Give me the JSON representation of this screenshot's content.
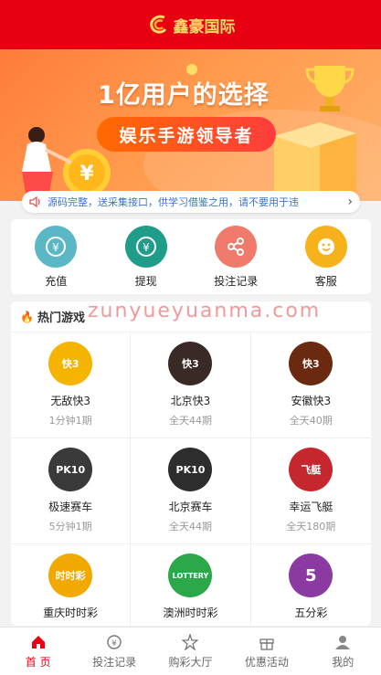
{
  "header": {
    "brand": "鑫豪国际",
    "logo_icon": "brand-logo-icon",
    "brand_color": "#e60012"
  },
  "banner": {
    "title": "1亿用户的选择",
    "subtitle": "娱乐手游领导者",
    "illustration_icons": [
      "trophy-icon",
      "coin-icon",
      "person-icon"
    ]
  },
  "notice": {
    "icon": "speaker-icon",
    "text": "源码完整，送采集接口，供学习借鉴之用，请不要用于违",
    "more_icon": "chevron-right-icon"
  },
  "quick_actions": [
    {
      "label": "充值",
      "icon": "recharge-icon",
      "color": "#5bb7c6"
    },
    {
      "label": "提现",
      "icon": "withdraw-icon",
      "color": "#1f9d8a"
    },
    {
      "label": "投注记录",
      "icon": "bet-record-icon",
      "color": "#f07a6b"
    },
    {
      "label": "客服",
      "icon": "customer-service-icon",
      "color": "#f6b21b"
    }
  ],
  "hot_section": {
    "title": "热门游戏",
    "flame_icon": "flame-icon"
  },
  "games": [
    {
      "name": "无敌快3",
      "info": "1分钟1期",
      "badge": "快3",
      "color": "#f5b400"
    },
    {
      "name": "北京快3",
      "info": "全天44期",
      "badge": "快3",
      "color": "#3a2a25"
    },
    {
      "name": "安徽快3",
      "info": "全天40期",
      "badge": "快3",
      "color": "#6b2a10"
    },
    {
      "name": "极速赛车",
      "info": "5分钟1期",
      "badge": "PK10",
      "color": "#3a3a3a"
    },
    {
      "name": "北京赛车",
      "info": "全天44期",
      "badge": "PK10",
      "color": "#2d2d2d"
    },
    {
      "name": "幸运飞艇",
      "info": "全天180期",
      "badge": "飞艇",
      "color": "#c6262e"
    },
    {
      "name": "重庆时时彩",
      "info": "",
      "badge": "时时彩",
      "color": "#f1a900"
    },
    {
      "name": "澳洲时时彩",
      "info": "",
      "badge": "LOTTERY",
      "color": "#2aa84a"
    },
    {
      "name": "五分彩",
      "info": "",
      "badge": "5",
      "color": "#8a3aa0"
    }
  ],
  "watermark": "zunyueyuanma.com",
  "tabbar": [
    {
      "label": "首 页",
      "icon": "home-icon",
      "active": true
    },
    {
      "label": "投注记录",
      "icon": "bet-record-tab-icon",
      "active": false
    },
    {
      "label": "购彩大厅",
      "icon": "lottery-hall-icon",
      "active": false
    },
    {
      "label": "优惠活动",
      "icon": "gift-icon",
      "active": false
    },
    {
      "label": "我的",
      "icon": "user-icon",
      "active": false
    }
  ]
}
